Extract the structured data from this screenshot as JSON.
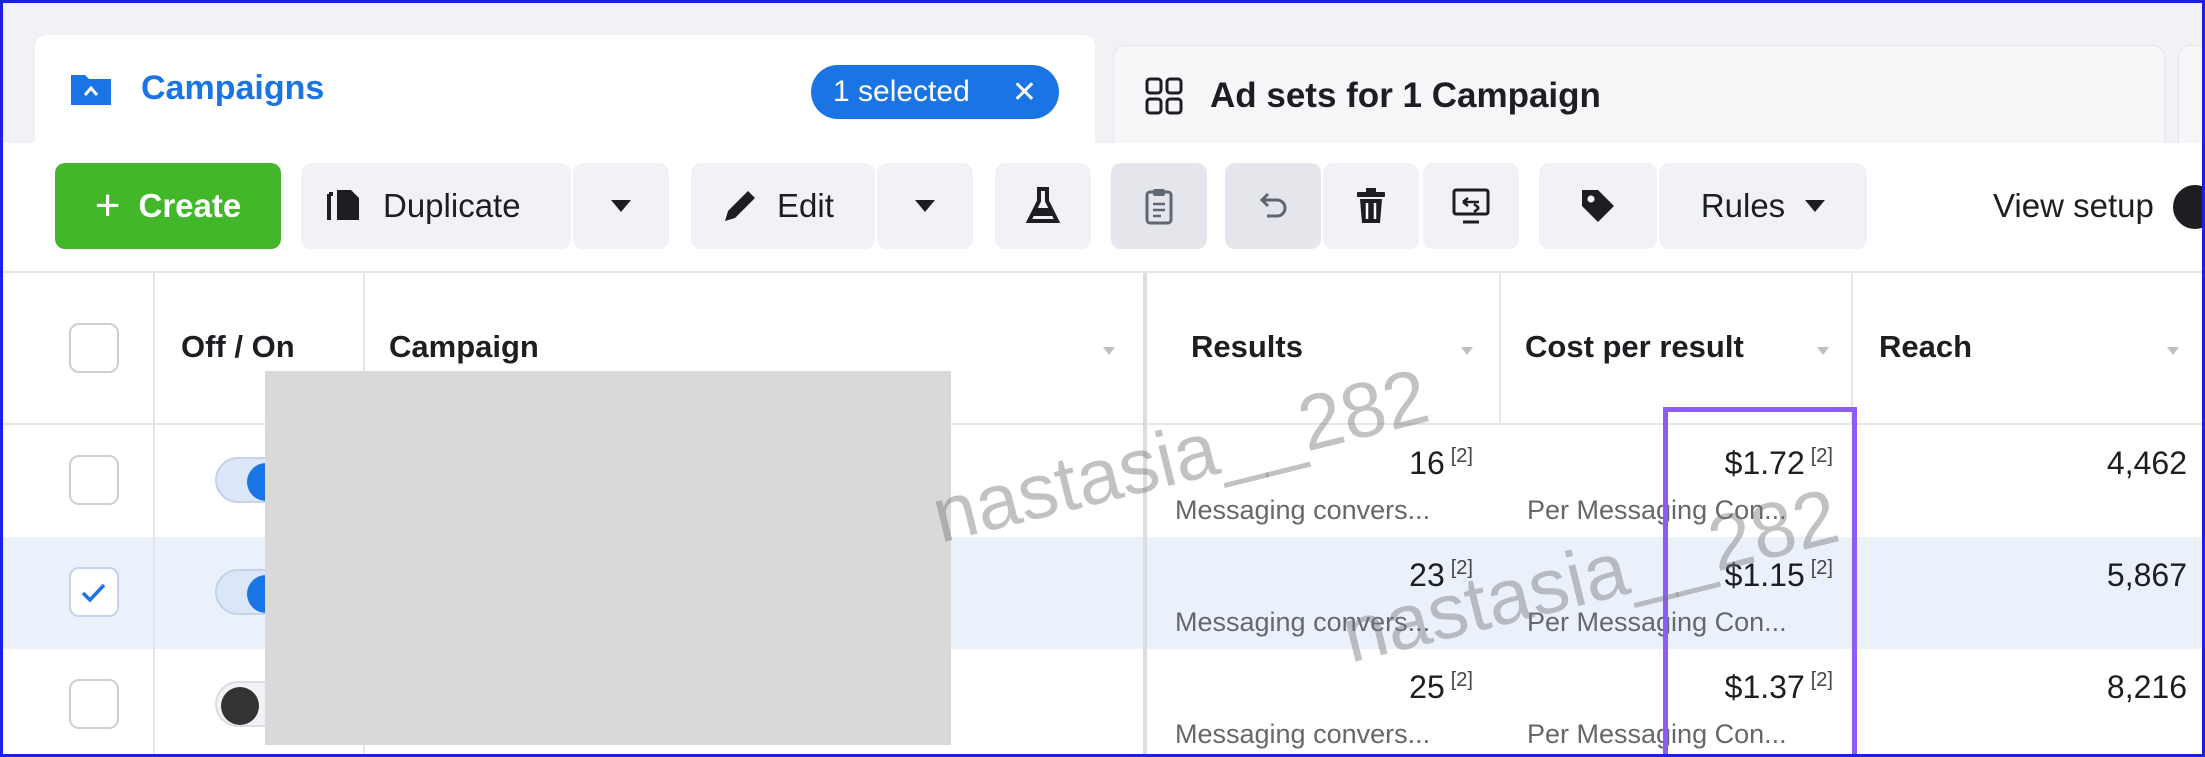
{
  "tabs": {
    "campaigns": {
      "title": "Campaigns",
      "selected_label": "1 selected",
      "clear_label": "✕"
    },
    "adsets": {
      "title": "Ad sets for 1 Campaign"
    }
  },
  "toolbar": {
    "create_label": "Create",
    "create_symbol": "+",
    "duplicate_label": "Duplicate",
    "edit_label": "Edit",
    "rules_label": "Rules",
    "view_setup_label": "View setup"
  },
  "table": {
    "columns": {
      "off_on": "Off / On",
      "campaign": "Campaign",
      "results": "Results",
      "cost_per_result": "Cost per result",
      "reach": "Reach"
    },
    "rows": [
      {
        "checked": false,
        "on": true,
        "results": "16",
        "results_note": "[2]",
        "results_sub": "Messaging convers...",
        "cost": "$1.72",
        "cost_note": "[2]",
        "cost_sub": "Per Messaging Con...",
        "reach": "4,462"
      },
      {
        "checked": true,
        "on": true,
        "results": "23",
        "results_note": "[2]",
        "results_sub": "Messaging convers...",
        "cost": "$1.15",
        "cost_note": "[2]",
        "cost_sub": "Per Messaging Con...",
        "reach": "5,867"
      },
      {
        "checked": false,
        "on": false,
        "results": "25",
        "results_note": "[2]",
        "results_sub": "Messaging convers...",
        "cost": "$1.37",
        "cost_note": "[2]",
        "cost_sub": "Per Messaging Con...",
        "reach": "8,216"
      }
    ]
  },
  "watermark": {
    "text_1": "nastasia__282",
    "text_2": "nastasia__282"
  },
  "colors": {
    "accent": "#1b74e4",
    "create": "#42b72a",
    "highlight": "#8b5cf6",
    "frame": "#1a20e8"
  }
}
